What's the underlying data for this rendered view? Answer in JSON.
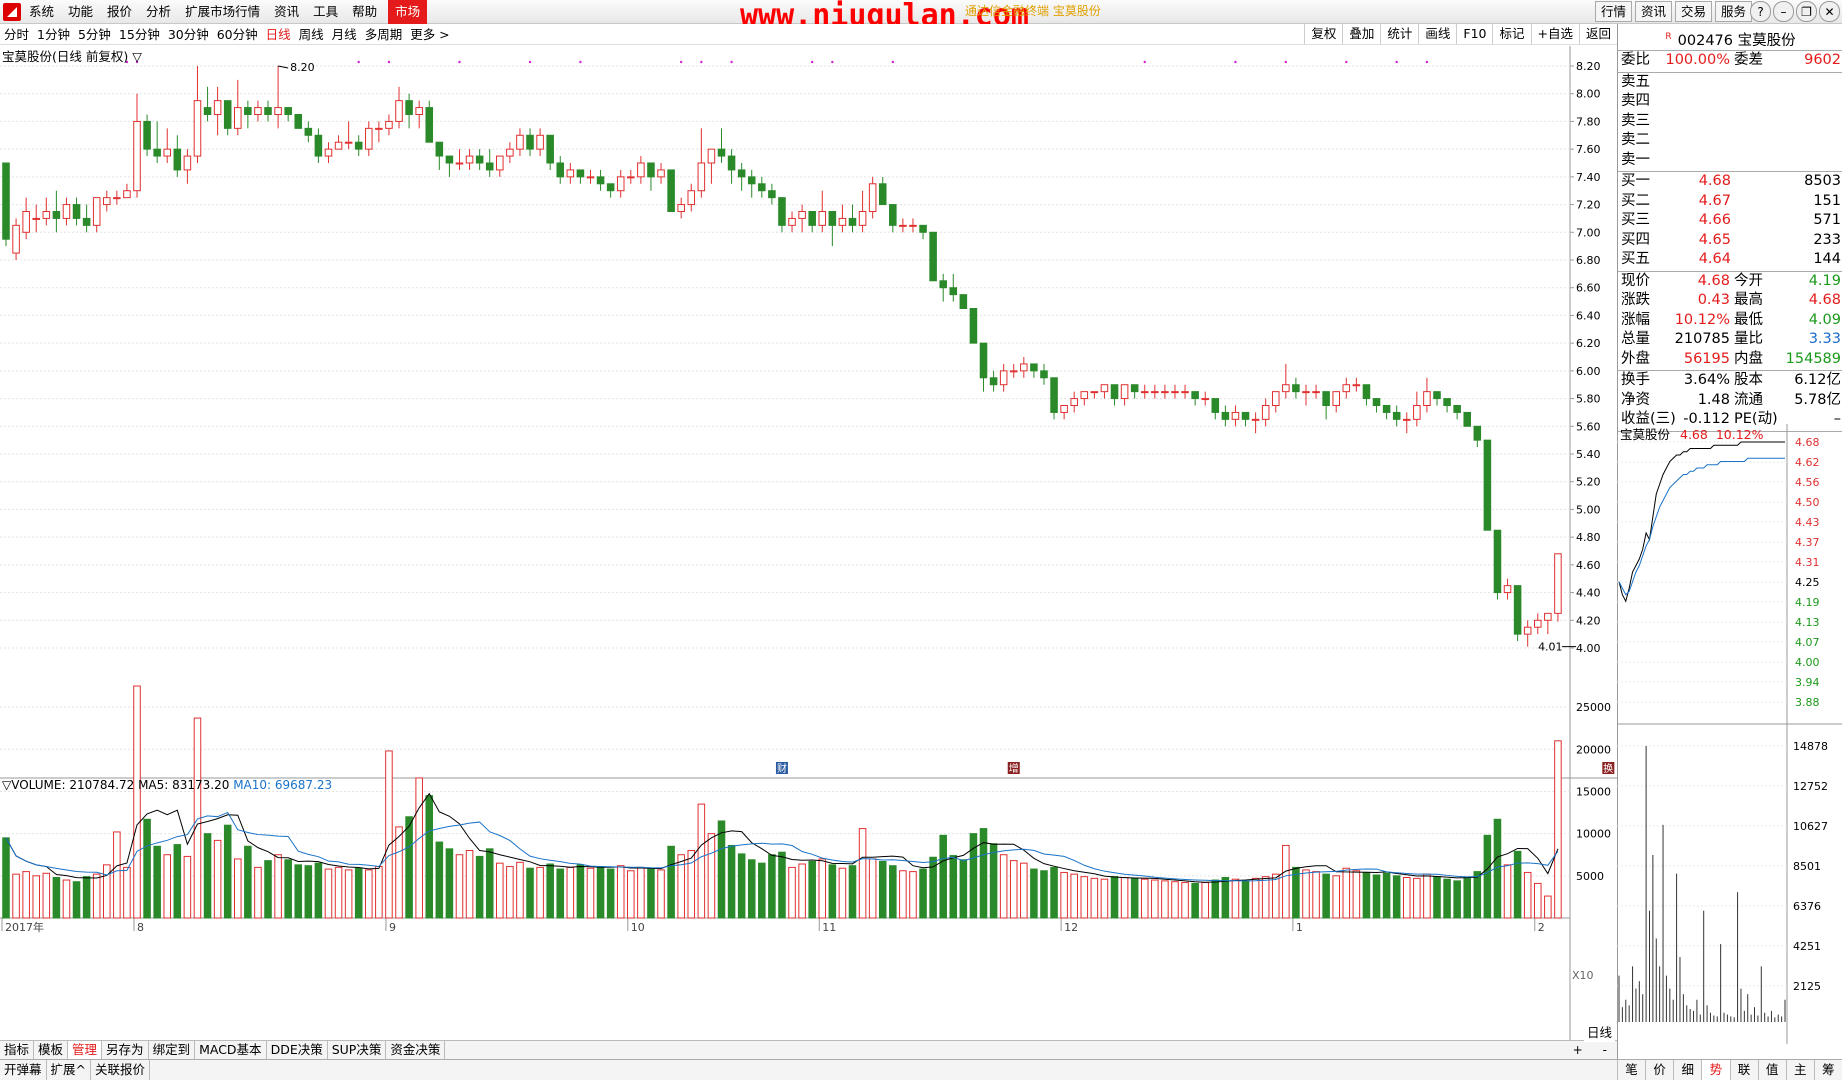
{
  "menu": {
    "items": [
      "系统",
      "功能",
      "报价",
      "分析",
      "扩展市场行情",
      "资讯",
      "工具",
      "帮助"
    ],
    "active": "市场"
  },
  "watermark": "www.niugulan.com",
  "window_title": "通达信金融终端 宝莫股份",
  "top_buttons": [
    "行情",
    "资讯",
    "交易",
    "服务"
  ],
  "period_tabs": [
    "分时",
    "1分钟",
    "5分钟",
    "15分钟",
    "30分钟",
    "60分钟",
    "日线",
    "周线",
    "月线",
    "多周期",
    "更多 >"
  ],
  "selected_period": "日线",
  "toolbar": [
    "复权",
    "叠加",
    "统计",
    "画线",
    "F10",
    "标记",
    "+自选",
    "返回"
  ],
  "chart_info": "宝莫股份(日线 前复权) ▽",
  "volume_info": {
    "label": "▽VOLUME: 210784.72",
    "ma5": "MA5: 83173.20",
    "ma10": "MA10: 69687.23"
  },
  "bottom_tabs": [
    "指标",
    "模板",
    "管理",
    "另存为",
    "绑定到",
    "MACD基本",
    "DDE决策",
    "SUP决策",
    "资金决策"
  ],
  "bottom_tab_selected": "管理",
  "bottom_right": [
    "+",
    "-"
  ],
  "status_tabs": [
    "开弹幕",
    "扩展^",
    "关联报价"
  ],
  "period_label": "日线",
  "quote": {
    "code": "002476",
    "name": "宝莫股份",
    "tag": "R",
    "weibi": {
      "label": "委比",
      "value": "100.00%",
      "label2": "委差",
      "value2": "9602"
    },
    "sell": [
      {
        "l": "卖五",
        "p": "",
        "v": ""
      },
      {
        "l": "卖四",
        "p": "",
        "v": ""
      },
      {
        "l": "卖三",
        "p": "",
        "v": ""
      },
      {
        "l": "卖二",
        "p": "",
        "v": ""
      },
      {
        "l": "卖一",
        "p": "",
        "v": ""
      }
    ],
    "buy": [
      {
        "l": "买一",
        "p": "4.68",
        "v": "8503"
      },
      {
        "l": "买二",
        "p": "4.67",
        "v": "151"
      },
      {
        "l": "买三",
        "p": "4.66",
        "v": "571"
      },
      {
        "l": "买四",
        "p": "4.65",
        "v": "233"
      },
      {
        "l": "买五",
        "p": "4.64",
        "v": "144"
      }
    ],
    "stats": [
      {
        "l1": "现价",
        "v1": "4.68",
        "c1": "r",
        "l2": "今开",
        "v2": "4.19",
        "c2": "g"
      },
      {
        "l1": "涨跌",
        "v1": "0.43",
        "c1": "r",
        "l2": "最高",
        "v2": "4.68",
        "c2": "r"
      },
      {
        "l1": "涨幅",
        "v1": "10.12%",
        "c1": "r",
        "l2": "最低",
        "v2": "4.09",
        "c2": "g"
      },
      {
        "l1": "总量",
        "v1": "210785",
        "c1": "",
        "l2": "量比",
        "v2": "3.33",
        "c2": "b"
      },
      {
        "l1": "外盘",
        "v1": "56195",
        "c1": "r",
        "l2": "内盘",
        "v2": "154589",
        "c2": "g"
      },
      {
        "l1": "换手",
        "v1": "3.64%",
        "c1": "",
        "l2": "股本",
        "v2": "6.12亿",
        "c2": ""
      },
      {
        "l1": "净资",
        "v1": "1.48",
        "c1": "",
        "l2": "流通",
        "v2": "5.78亿",
        "c2": ""
      },
      {
        "l1": "收益(三)",
        "v1": "-0.112",
        "c1": "",
        "l2": "PE(动)",
        "v2": "–",
        "c2": ""
      }
    ]
  },
  "intraday": {
    "title": "宝莫股份",
    "price": "4.68",
    "pct": "10.12%",
    "price_ticks": [
      "4.68",
      "4.62",
      "4.56",
      "4.50",
      "4.43",
      "4.37",
      "4.31",
      "4.25",
      "4.19",
      "4.13",
      "4.07",
      "4.00",
      "3.94",
      "3.88"
    ],
    "vol_ticks": [
      "14878",
      "12752",
      "10627",
      "8501",
      "6376",
      "4251",
      "2125"
    ]
  },
  "right_tabs": [
    "笔",
    "价",
    "细",
    "势",
    "联",
    "值",
    "主",
    "筹"
  ],
  "right_tab_selected": "势",
  "chart_data": {
    "type": "candlestick",
    "title": "宝莫股份(日线 前复权)",
    "price_axis": [
      "8.20",
      "8.00",
      "7.80",
      "7.60",
      "7.40",
      "7.20",
      "7.00",
      "6.80",
      "6.60",
      "6.40",
      "6.20",
      "6.00",
      "5.80",
      "5.60",
      "5.40",
      "5.20",
      "5.00",
      "4.80",
      "4.60",
      "4.40",
      "4.20",
      "4.00"
    ],
    "volume_axis": [
      "25000",
      "20000",
      "15000",
      "10000",
      "5000"
    ],
    "volume_unit": "X10",
    "x_labels": [
      {
        "t": "2017年",
        "i": 0
      },
      {
        "t": "8",
        "i": 13
      },
      {
        "t": "9",
        "i": 38
      },
      {
        "t": "10",
        "i": 62
      },
      {
        "t": "11",
        "i": 81
      },
      {
        "t": "12",
        "i": 105
      },
      {
        "t": "1",
        "i": 128
      },
      {
        "t": "2",
        "i": 152
      }
    ],
    "high_label": "8.20",
    "low_label": "4.01",
    "markers": [
      {
        "t": "财",
        "i": 77
      },
      {
        "t": "增",
        "i": 100
      },
      {
        "t": "换",
        "i": 159
      }
    ],
    "ohlc": [
      [
        7.5,
        7.5,
        6.9,
        6.95,
        9500
      ],
      [
        6.85,
        7.1,
        6.8,
        7.05,
        5200
      ],
      [
        7.0,
        7.25,
        6.95,
        7.15,
        5500
      ],
      [
        7.1,
        7.2,
        7.0,
        7.1,
        5000
      ],
      [
        7.1,
        7.25,
        7.05,
        7.15,
        5300
      ],
      [
        7.15,
        7.3,
        7.0,
        7.1,
        4800
      ],
      [
        7.1,
        7.25,
        7.05,
        7.2,
        4500
      ],
      [
        7.2,
        7.25,
        7.05,
        7.1,
        4300
      ],
      [
        7.1,
        7.2,
        7.0,
        7.05,
        4900
      ],
      [
        7.05,
        7.25,
        7.0,
        7.25,
        5200
      ],
      [
        7.2,
        7.3,
        7.15,
        7.25,
        6300
      ],
      [
        7.25,
        7.3,
        7.2,
        7.25,
        10200
      ],
      [
        7.25,
        7.35,
        7.25,
        7.3,
        6000
      ],
      [
        7.3,
        8.0,
        7.25,
        7.8,
        27500
      ],
      [
        7.8,
        7.85,
        7.55,
        7.6,
        11700
      ],
      [
        7.6,
        7.8,
        7.5,
        7.55,
        8500
      ],
      [
        7.55,
        7.75,
        7.5,
        7.6,
        7500
      ],
      [
        7.6,
        7.7,
        7.4,
        7.45,
        8700
      ],
      [
        7.45,
        7.6,
        7.35,
        7.55,
        7300
      ],
      [
        7.55,
        8.2,
        7.5,
        7.95,
        23700
      ],
      [
        7.9,
        8.05,
        7.8,
        7.85,
        10000
      ],
      [
        7.85,
        8.05,
        7.7,
        7.95,
        9200
      ],
      [
        7.95,
        7.95,
        7.7,
        7.75,
        11000
      ],
      [
        7.75,
        8.1,
        7.7,
        7.9,
        7000
      ],
      [
        7.9,
        7.95,
        7.75,
        7.85,
        8500
      ],
      [
        7.85,
        7.95,
        7.8,
        7.9,
        6000
      ],
      [
        7.9,
        7.95,
        7.8,
        7.85,
        6800
      ],
      [
        7.85,
        8.2,
        7.75,
        7.9,
        7500
      ],
      [
        7.9,
        7.9,
        7.8,
        7.85,
        6900
      ],
      [
        7.85,
        7.85,
        7.75,
        7.75,
        6300
      ],
      [
        7.75,
        7.8,
        7.65,
        7.7,
        6200
      ],
      [
        7.7,
        7.75,
        7.5,
        7.55,
        6500
      ],
      [
        7.55,
        7.65,
        7.5,
        7.6,
        5800
      ],
      [
        7.6,
        7.7,
        7.6,
        7.65,
        6000
      ],
      [
        7.65,
        7.8,
        7.6,
        7.65,
        5700
      ],
      [
        7.65,
        7.7,
        7.55,
        7.6,
        5900
      ],
      [
        7.6,
        7.8,
        7.55,
        7.75,
        5700
      ],
      [
        7.75,
        7.8,
        7.65,
        7.75,
        6100
      ],
      [
        7.75,
        7.85,
        7.7,
        7.8,
        19800
      ],
      [
        7.8,
        8.05,
        7.75,
        7.95,
        10800
      ],
      [
        7.95,
        8.0,
        7.75,
        7.85,
        12000
      ],
      [
        7.85,
        7.95,
        7.75,
        7.9,
        16600
      ],
      [
        7.9,
        7.95,
        7.65,
        7.65,
        14500
      ],
      [
        7.65,
        7.65,
        7.45,
        7.55,
        9000
      ],
      [
        7.55,
        7.55,
        7.4,
        7.5,
        8200
      ],
      [
        7.5,
        7.6,
        7.45,
        7.5,
        7500
      ],
      [
        7.5,
        7.6,
        7.45,
        7.55,
        8000
      ],
      [
        7.55,
        7.6,
        7.45,
        7.5,
        7300
      ],
      [
        7.5,
        7.6,
        7.4,
        7.45,
        8200
      ],
      [
        7.45,
        7.55,
        7.4,
        7.55,
        6500
      ],
      [
        7.55,
        7.65,
        7.5,
        7.6,
        6100
      ],
      [
        7.6,
        7.75,
        7.55,
        7.7,
        6600
      ],
      [
        7.7,
        7.75,
        7.55,
        7.6,
        5900
      ],
      [
        7.6,
        7.75,
        7.55,
        7.7,
        6000
      ],
      [
        7.7,
        7.7,
        7.45,
        7.5,
        6400
      ],
      [
        7.5,
        7.55,
        7.35,
        7.4,
        5800
      ],
      [
        7.4,
        7.5,
        7.35,
        7.45,
        6000
      ],
      [
        7.45,
        7.45,
        7.35,
        7.4,
        6300
      ],
      [
        7.4,
        7.45,
        7.35,
        7.4,
        5900
      ],
      [
        7.4,
        7.45,
        7.3,
        7.35,
        6100
      ],
      [
        7.35,
        7.35,
        7.25,
        7.3,
        5800
      ],
      [
        7.3,
        7.45,
        7.25,
        7.4,
        6200
      ],
      [
        7.4,
        7.45,
        7.35,
        7.4,
        5600
      ],
      [
        7.4,
        7.55,
        7.35,
        7.5,
        6000
      ],
      [
        7.5,
        7.5,
        7.3,
        7.4,
        5800
      ],
      [
        7.4,
        7.5,
        7.35,
        7.45,
        5700
      ],
      [
        7.45,
        7.45,
        7.15,
        7.15,
        8500
      ],
      [
        7.15,
        7.25,
        7.1,
        7.2,
        7500
      ],
      [
        7.2,
        7.35,
        7.15,
        7.3,
        8000
      ],
      [
        7.3,
        7.75,
        7.25,
        7.5,
        13500
      ],
      [
        7.5,
        7.55,
        7.35,
        7.6,
        10000
      ],
      [
        7.6,
        7.75,
        7.5,
        7.55,
        11500
      ],
      [
        7.55,
        7.6,
        7.35,
        7.45,
        8600
      ],
      [
        7.45,
        7.5,
        7.3,
        7.4,
        7600
      ],
      [
        7.4,
        7.45,
        7.25,
        7.35,
        6900
      ],
      [
        7.35,
        7.4,
        7.25,
        7.3,
        6500
      ],
      [
        7.3,
        7.35,
        7.2,
        7.25,
        7500
      ],
      [
        7.25,
        7.25,
        7.0,
        7.05,
        7800
      ],
      [
        7.05,
        7.15,
        7.0,
        7.1,
        6000
      ],
      [
        7.1,
        7.2,
        7.0,
        7.15,
        6400
      ],
      [
        7.15,
        7.15,
        7.0,
        7.05,
        6700
      ],
      [
        7.05,
        7.3,
        7.0,
        7.15,
        7000
      ],
      [
        7.15,
        7.15,
        6.9,
        7.05,
        6300
      ],
      [
        7.05,
        7.2,
        7.0,
        7.1,
        5900
      ],
      [
        7.1,
        7.2,
        7.0,
        7.05,
        6200
      ],
      [
        7.05,
        7.3,
        7.0,
        7.15,
        10600
      ],
      [
        7.15,
        7.4,
        7.1,
        7.35,
        7000
      ],
      [
        7.35,
        7.4,
        7.2,
        7.2,
        6700
      ],
      [
        7.2,
        7.2,
        7.0,
        7.05,
        6200
      ],
      [
        7.05,
        7.1,
        7.0,
        7.05,
        5600
      ],
      [
        7.05,
        7.1,
        7.0,
        7.05,
        5500
      ],
      [
        7.05,
        7.05,
        6.95,
        7.0,
        5800
      ],
      [
        7.0,
        7.0,
        6.65,
        6.65,
        7200
      ],
      [
        6.65,
        6.7,
        6.5,
        6.6,
        9800
      ],
      [
        6.6,
        6.7,
        6.5,
        6.55,
        7400
      ],
      [
        6.55,
        6.55,
        6.45,
        6.45,
        6900
      ],
      [
        6.45,
        6.45,
        6.2,
        6.2,
        10000
      ],
      [
        6.2,
        6.2,
        5.85,
        5.95,
        10600
      ],
      [
        5.95,
        6.0,
        5.85,
        5.9,
        8800
      ],
      [
        5.9,
        6.05,
        5.85,
        6.0,
        7500
      ],
      [
        6.0,
        6.05,
        5.95,
        6.0,
        6800
      ],
      [
        6.0,
        6.1,
        5.95,
        6.05,
        6500
      ],
      [
        6.05,
        6.05,
        5.95,
        6.0,
        5800
      ],
      [
        6.0,
        6.05,
        5.9,
        5.95,
        5600
      ],
      [
        5.95,
        5.95,
        5.65,
        5.7,
        6000
      ],
      [
        5.7,
        5.75,
        5.65,
        5.75,
        5400
      ],
      [
        5.75,
        5.85,
        5.7,
        5.8,
        5200
      ],
      [
        5.8,
        5.85,
        5.75,
        5.85,
        4900
      ],
      [
        5.85,
        5.85,
        5.8,
        5.85,
        4700
      ],
      [
        5.85,
        5.9,
        5.8,
        5.9,
        4600
      ],
      [
        5.9,
        5.9,
        5.75,
        5.8,
        4900
      ],
      [
        5.8,
        5.9,
        5.75,
        5.9,
        4800
      ],
      [
        5.9,
        5.9,
        5.8,
        5.85,
        4700
      ],
      [
        5.85,
        5.9,
        5.8,
        5.85,
        4600
      ],
      [
        5.85,
        5.9,
        5.8,
        5.85,
        4500
      ],
      [
        5.85,
        5.9,
        5.8,
        5.85,
        4400
      ],
      [
        5.85,
        5.9,
        5.8,
        5.85,
        4300
      ],
      [
        5.85,
        5.9,
        5.8,
        5.85,
        4200
      ],
      [
        5.85,
        5.85,
        5.75,
        5.8,
        4100
      ],
      [
        5.8,
        5.85,
        5.75,
        5.8,
        4200
      ],
      [
        5.8,
        5.8,
        5.65,
        5.7,
        4500
      ],
      [
        5.7,
        5.75,
        5.6,
        5.65,
        4800
      ],
      [
        5.65,
        5.75,
        5.6,
        5.7,
        4600
      ],
      [
        5.7,
        5.7,
        5.6,
        5.65,
        4400
      ],
      [
        5.65,
        5.7,
        5.55,
        5.65,
        4700
      ],
      [
        5.65,
        5.8,
        5.6,
        5.75,
        4900
      ],
      [
        5.75,
        5.85,
        5.7,
        5.85,
        5200
      ],
      [
        5.85,
        6.05,
        5.8,
        5.9,
        8600
      ],
      [
        5.9,
        5.95,
        5.8,
        5.85,
        6000
      ],
      [
        5.85,
        5.9,
        5.75,
        5.85,
        5700
      ],
      [
        5.85,
        5.9,
        5.8,
        5.85,
        5500
      ],
      [
        5.85,
        5.85,
        5.65,
        5.75,
        5200
      ],
      [
        5.75,
        5.85,
        5.7,
        5.85,
        5000
      ],
      [
        5.85,
        5.95,
        5.8,
        5.9,
        5900
      ],
      [
        5.9,
        5.95,
        5.85,
        5.9,
        5600
      ],
      [
        5.9,
        5.9,
        5.75,
        5.8,
        5400
      ],
      [
        5.8,
        5.8,
        5.7,
        5.75,
        5100
      ],
      [
        5.75,
        5.75,
        5.65,
        5.7,
        5300
      ],
      [
        5.7,
        5.75,
        5.6,
        5.65,
        5000
      ],
      [
        5.65,
        5.7,
        5.55,
        5.65,
        4800
      ],
      [
        5.65,
        5.85,
        5.6,
        5.75,
        4700
      ],
      [
        5.75,
        5.95,
        5.7,
        5.85,
        5200
      ],
      [
        5.85,
        5.85,
        5.75,
        5.8,
        4900
      ],
      [
        5.8,
        5.8,
        5.7,
        5.75,
        4600
      ],
      [
        5.75,
        5.75,
        5.65,
        5.7,
        4400
      ],
      [
        5.7,
        5.7,
        5.6,
        5.6,
        4800
      ],
      [
        5.6,
        5.6,
        5.45,
        5.5,
        5500
      ],
      [
        5.5,
        5.5,
        4.85,
        4.85,
        9800
      ],
      [
        4.85,
        4.85,
        4.35,
        4.4,
        11700
      ],
      [
        4.4,
        4.5,
        4.35,
        4.45,
        6300
      ],
      [
        4.45,
        4.45,
        4.05,
        4.1,
        7900
      ],
      [
        4.1,
        4.2,
        4.01,
        4.15,
        5400
      ],
      [
        4.15,
        4.25,
        4.1,
        4.2,
        4100
      ],
      [
        4.2,
        4.25,
        4.1,
        4.25,
        2600
      ],
      [
        4.25,
        4.68,
        4.19,
        4.68,
        21000
      ]
    ]
  },
  "intraday_data": {
    "prices": [
      4.25,
      4.21,
      4.19,
      4.23,
      4.28,
      4.3,
      4.32,
      4.35,
      4.4,
      4.38,
      4.45,
      4.52,
      4.55,
      4.58,
      4.6,
      4.62,
      4.63,
      4.64,
      4.64,
      4.65,
      4.65,
      4.66,
      4.66,
      4.66,
      4.66,
      4.66,
      4.66,
      4.66,
      4.67,
      4.67,
      4.67,
      4.67,
      4.67,
      4.67,
      4.67,
      4.67,
      4.68,
      4.68,
      4.68,
      4.68,
      4.68,
      4.68,
      4.68,
      4.68,
      4.68,
      4.68,
      4.68,
      4.68,
      4.68,
      4.68
    ],
    "avg": [
      4.25,
      4.23,
      4.21,
      4.22,
      4.25,
      4.28,
      4.3,
      4.33,
      4.36,
      4.38,
      4.42,
      4.45,
      4.48,
      4.5,
      4.52,
      4.54,
      4.55,
      4.56,
      4.57,
      4.58,
      4.58,
      4.59,
      4.59,
      4.6,
      4.6,
      4.6,
      4.61,
      4.61,
      4.61,
      4.61,
      4.62,
      4.62,
      4.62,
      4.62,
      4.62,
      4.62,
      4.62,
      4.62,
      4.63,
      4.63,
      4.63,
      4.63,
      4.63,
      4.63,
      4.63,
      4.63,
      4.63,
      4.63,
      4.63,
      4.63
    ],
    "vols": [
      2500,
      800,
      1200,
      900,
      3000,
      1800,
      2200,
      1500,
      14878,
      6000,
      9000,
      4500,
      3000,
      10627,
      2500,
      1800,
      1200,
      8000,
      3500,
      1500,
      900,
      700,
      600,
      1200,
      400,
      6000,
      900,
      500,
      350,
      300,
      4200,
      500,
      400,
      300,
      250,
      7000,
      1800,
      600,
      1500,
      400,
      800,
      350,
      3000,
      500,
      300,
      600,
      250,
      400,
      300,
      1200
    ]
  }
}
